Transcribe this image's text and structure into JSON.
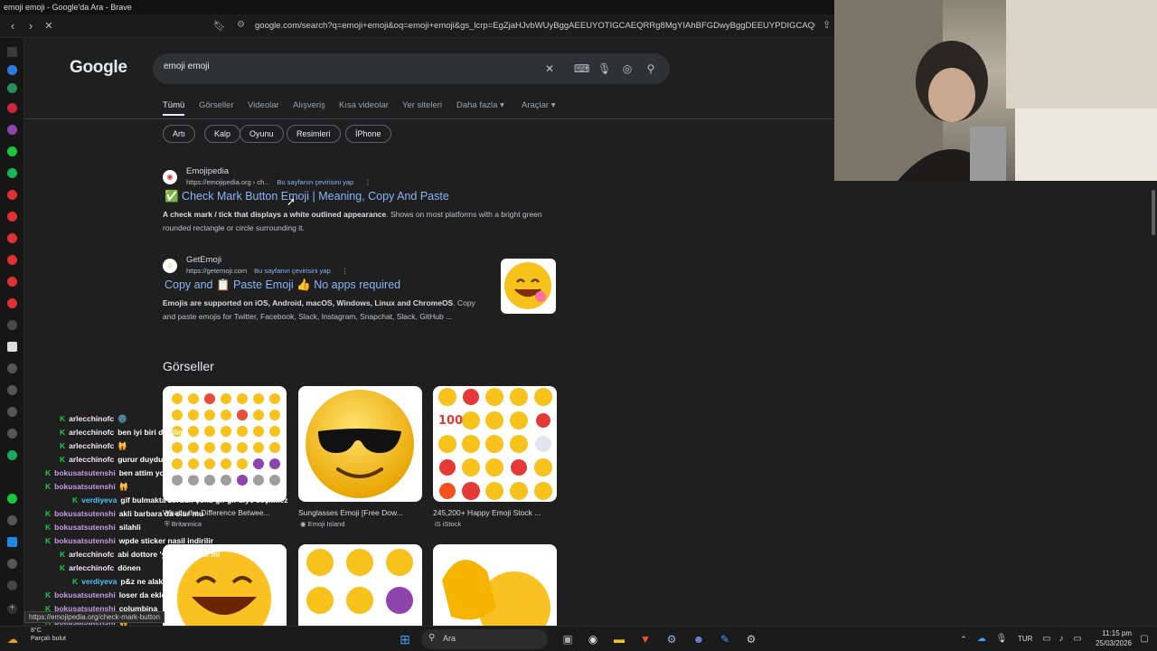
{
  "window": {
    "title": "emoji emoji - Google'da Ara - Brave"
  },
  "browser": {
    "url": "google.com/search?q=emoji+emoji&oq=emoji+emoji&gs_lcrp=EgZjaHJvbWUyBggAEEUYOTIGCAEQRRg8MgYIAhBFGDwyBggDEEUYPDIGCAQQLhh...",
    "status_url": "https://emojipedia.org/check-mark-button"
  },
  "google": {
    "logo": "Google",
    "query": "emoji emoji",
    "tabs": [
      "Tümü",
      "Görseller",
      "Videolar",
      "Alışveriş",
      "Kısa videolar",
      "Yer siteleri",
      "Daha fazla",
      "Araçlar"
    ],
    "chips": [
      "Artı",
      "Kalp",
      "Oyunu",
      "Resimleri",
      "İPhone"
    ],
    "results": [
      {
        "site": "Emojipedia",
        "url": "https://emojipedia.org › ch...",
        "translate": "Bu sayfanın çevirisini yap",
        "title": "✅ Check Mark Button Emoji | Meaning, Copy And Paste",
        "snippet_bold": "A check mark / tick that displays a white outlined appearance",
        "snippet": ". Shows on most platforms with a bright green rounded rectangle or circle surrounding it."
      },
      {
        "site": "GetEmoji",
        "url": "https://getemoji.com",
        "translate": "Bu sayfanın çevirisini yap",
        "title": "Copy and 📋 Paste Emoji 👍 No apps required",
        "snippet_bold": "Emojis are supported on iOS, Android, macOS, Windows, Linux and ChromeOS",
        "snippet": ". Copy and paste emojis for Twitter, Facebook, Slack, Instagram, Snapchat, Slack, GitHub ..."
      }
    ],
    "images_heading": "Görseller",
    "images": [
      {
        "caption": "What's the Difference Betwee...",
        "source": "Britannica"
      },
      {
        "caption": "Sunglasses Emoji [Free Dow...",
        "source": "Emoji Island"
      },
      {
        "caption": "245,200+ Happy Emoji Stock ...",
        "source": "iStock"
      }
    ]
  },
  "chat": [
    {
      "user": "arlecchinofc",
      "msg": "🌚",
      "style": "u1"
    },
    {
      "user": "arlecchinofc",
      "msg": "ben iyi biri degilim",
      "style": "u1"
    },
    {
      "user": "arlecchinofc",
      "msg": "🙀",
      "style": "u1"
    },
    {
      "user": "arlecchinofc",
      "msg": "gurur duydum",
      "style": "u1"
    },
    {
      "user": "bokusatsutenshi",
      "msg": "ben attim yoksa bi daha",
      "style": "u2"
    },
    {
      "user": "bokusatsutenshi",
      "msg": "🙀",
      "style": "u2"
    },
    {
      "user": "verdiyeva",
      "msg": "gif bulmakta zorduk çoku gif gif diye seçilmez",
      "style": "u3"
    },
    {
      "user": "bokusatsutenshi",
      "msg": "akli barbara da olur mu",
      "style": "u2"
    },
    {
      "user": "bokusatsutenshi",
      "msg": "silahli",
      "style": "u2"
    },
    {
      "user": "bokusatsutenshi",
      "msg": "wpde sticker nasil indirilir",
      "style": "u2"
    },
    {
      "user": "arlecchinofc",
      "msg": "abi dottore 'yi de ekleyek mi",
      "style": "u1"
    },
    {
      "user": "arlecchinofc",
      "msg": "dönen",
      "style": "u1"
    },
    {
      "user": "verdiyeva",
      "msg": "p&z ne alaka",
      "style": "u3"
    },
    {
      "user": "bokusatsutenshi",
      "msg": "loser da ekleyel",
      "style": "u2"
    },
    {
      "user": "bokusatsutenshi",
      "msg": "columbina",
      "style": "u2"
    },
    {
      "user": "bokusatsutenshi",
      "msg": "🙀",
      "style": "u2"
    }
  ],
  "taskbar": {
    "search_placeholder": "Ara",
    "language": "TUR",
    "time": "11:15 pm",
    "date": "25/03/2026",
    "weather": "8°C",
    "weather_desc": "Parçalı bulut"
  }
}
